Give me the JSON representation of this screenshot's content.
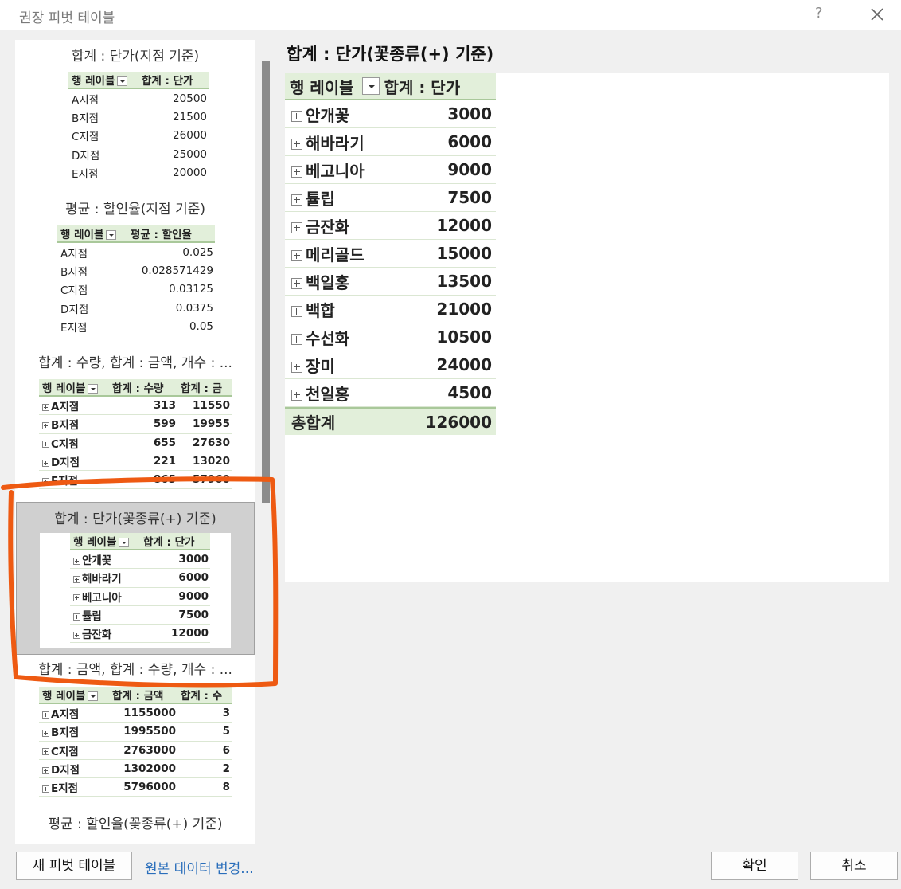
{
  "window": {
    "title": "권장 피벗 테이블",
    "help": "?"
  },
  "left_list": [
    {
      "title": "합계 : 단가(지점 기준)",
      "header": [
        "행 레이블",
        "합계 : 단가"
      ],
      "rows": [
        [
          "A지점",
          "20500"
        ],
        [
          "B지점",
          "21500"
        ],
        [
          "C지점",
          "26000"
        ],
        [
          "D지점",
          "25000"
        ],
        [
          "E지점",
          "20000"
        ]
      ]
    },
    {
      "title": "평균 : 할인율(지점 기준)",
      "header": [
        "행 레이블",
        "평균 : 할인율"
      ],
      "rows": [
        [
          "A지점",
          "0.025"
        ],
        [
          "B지점",
          "0.028571429"
        ],
        [
          "C지점",
          "0.03125"
        ],
        [
          "D지점",
          "0.0375"
        ],
        [
          "E지점",
          "0.05"
        ]
      ]
    },
    {
      "title": "합계 : 수량, 합계 : 금액, 개수 : ...",
      "header": [
        "행 레이블",
        "합계 : 수량",
        "합계 : 금"
      ],
      "rows": [
        [
          "A지점",
          "313",
          "11550"
        ],
        [
          "B지점",
          "599",
          "19955"
        ],
        [
          "C지점",
          "655",
          "27630"
        ],
        [
          "D지점",
          "221",
          "13020"
        ],
        [
          "E지점",
          "865",
          "57960"
        ]
      ]
    },
    {
      "title": "합계 : 단가(꽃종류(+) 기준)",
      "header": [
        "행 레이블",
        "합계 : 단가"
      ],
      "rows": [
        [
          "안개꽃",
          "3000"
        ],
        [
          "해바라기",
          "6000"
        ],
        [
          "베고니아",
          "9000"
        ],
        [
          "튤립",
          "7500"
        ],
        [
          "금잔화",
          "12000"
        ]
      ]
    },
    {
      "title": "합계 : 금액, 합계 : 수량, 개수 : ...",
      "header": [
        "행 레이블",
        "합계 : 금액",
        "합계 : 수"
      ],
      "rows": [
        [
          "A지점",
          "1155000",
          "3"
        ],
        [
          "B지점",
          "1995500",
          "5"
        ],
        [
          "C지점",
          "2763000",
          "6"
        ],
        [
          "D지점",
          "1302000",
          "2"
        ],
        [
          "E지점",
          "5796000",
          "8"
        ]
      ]
    },
    {
      "title": "평균 : 할인율(꽃종류(+) 기준)"
    }
  ],
  "preview": {
    "title": "합계 : 단가(꽃종류(+) 기준)",
    "header": [
      "행 레이블",
      "합계 : 단가"
    ],
    "rows": [
      [
        "안개꽃",
        "3000"
      ],
      [
        "해바라기",
        "6000"
      ],
      [
        "베고니아",
        "9000"
      ],
      [
        "튤립",
        "7500"
      ],
      [
        "금잔화",
        "12000"
      ],
      [
        "메리골드",
        "15000"
      ],
      [
        "백일홍",
        "13500"
      ],
      [
        "백합",
        "21000"
      ],
      [
        "수선화",
        "10500"
      ],
      [
        "장미",
        "24000"
      ],
      [
        "천일홍",
        "4500"
      ]
    ],
    "total": [
      "총합계",
      "126000"
    ]
  },
  "buttons": {
    "new_pivot": "새 피벗 테이블",
    "change_source": "원본 데이터 변경...",
    "ok": "확인",
    "cancel": "취소"
  },
  "colors": {
    "header_fill": "#e2efda",
    "selection": "#d0d0d0",
    "annotation": "#ee5a12",
    "link": "#2a6ebb"
  }
}
